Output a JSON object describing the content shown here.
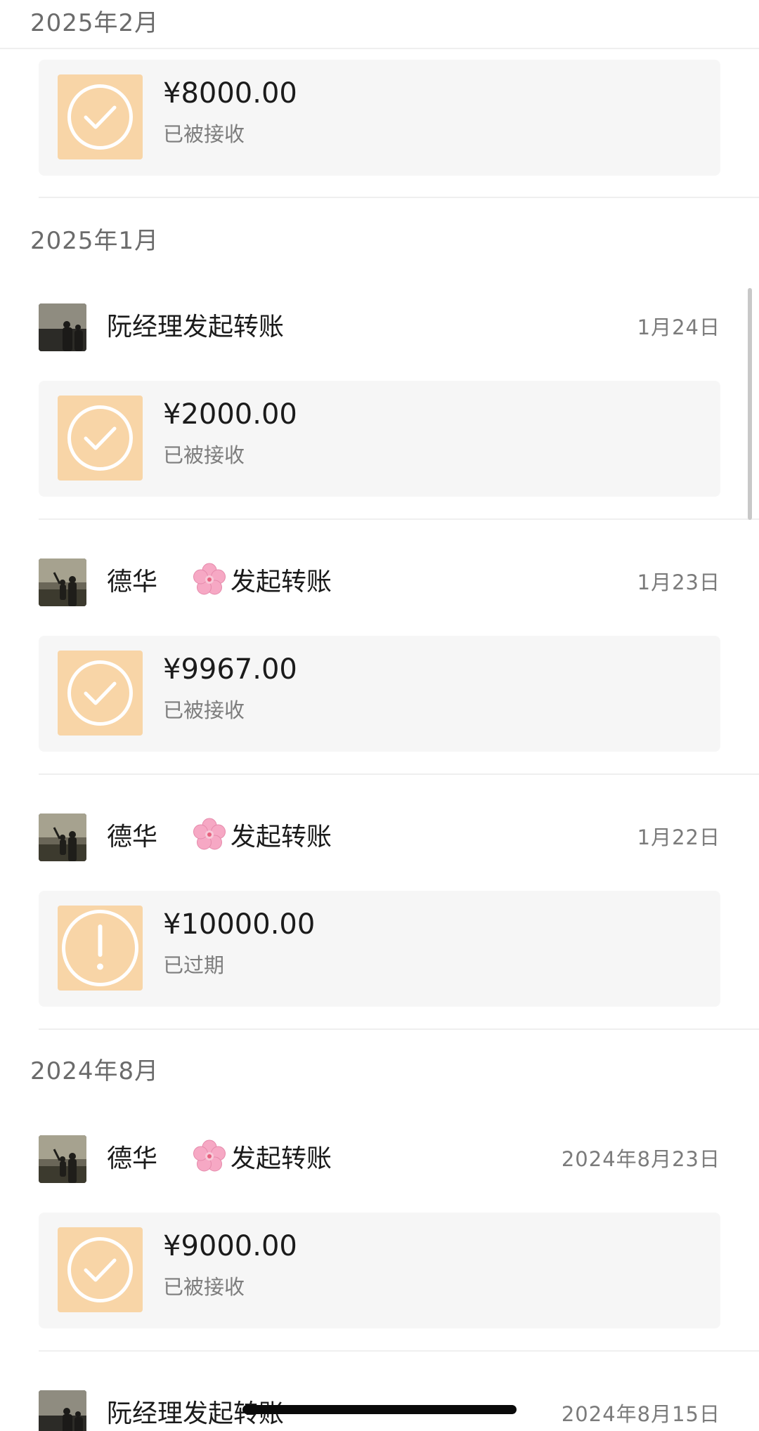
{
  "sections": [
    {
      "month": "2025年2月",
      "entries": [
        {
          "amount": "¥8000.00",
          "status": "已被接收",
          "status_icon": "check-icon"
        }
      ]
    },
    {
      "month": "2025年1月",
      "entries": [
        {
          "initiator_name": "阮经理",
          "initiator_suffix": "发起转账",
          "date": "1月24日",
          "amount": "¥2000.00",
          "status": "已被接收",
          "status_icon": "check-icon"
        },
        {
          "initiator_name": "德华",
          "initiator_emoji": "cherry-blossom",
          "initiator_suffix": "发起转账",
          "date": "1月23日",
          "amount": "¥9967.00",
          "status": "已被接收",
          "status_icon": "check-icon"
        },
        {
          "initiator_name": "德华",
          "initiator_emoji": "cherry-blossom",
          "initiator_suffix": "发起转账",
          "date": "1月22日",
          "amount": "¥10000.00",
          "status": "已过期",
          "status_icon": "exclamation-icon"
        }
      ]
    },
    {
      "month": "2024年8月",
      "entries": [
        {
          "initiator_name": "德华",
          "initiator_emoji": "cherry-blossom",
          "initiator_suffix": "发起转账",
          "date": "2024年8月23日",
          "amount": "¥9000.00",
          "status": "已被接收",
          "status_icon": "check-icon"
        },
        {
          "initiator_name": "阮经理",
          "initiator_suffix": "发起转账",
          "date": "2024年8月15日"
        }
      ]
    }
  ],
  "colors": {
    "icon_background": "#f8d5a7",
    "card_background": "#f6f6f6",
    "header_text": "#6b6b6b"
  }
}
